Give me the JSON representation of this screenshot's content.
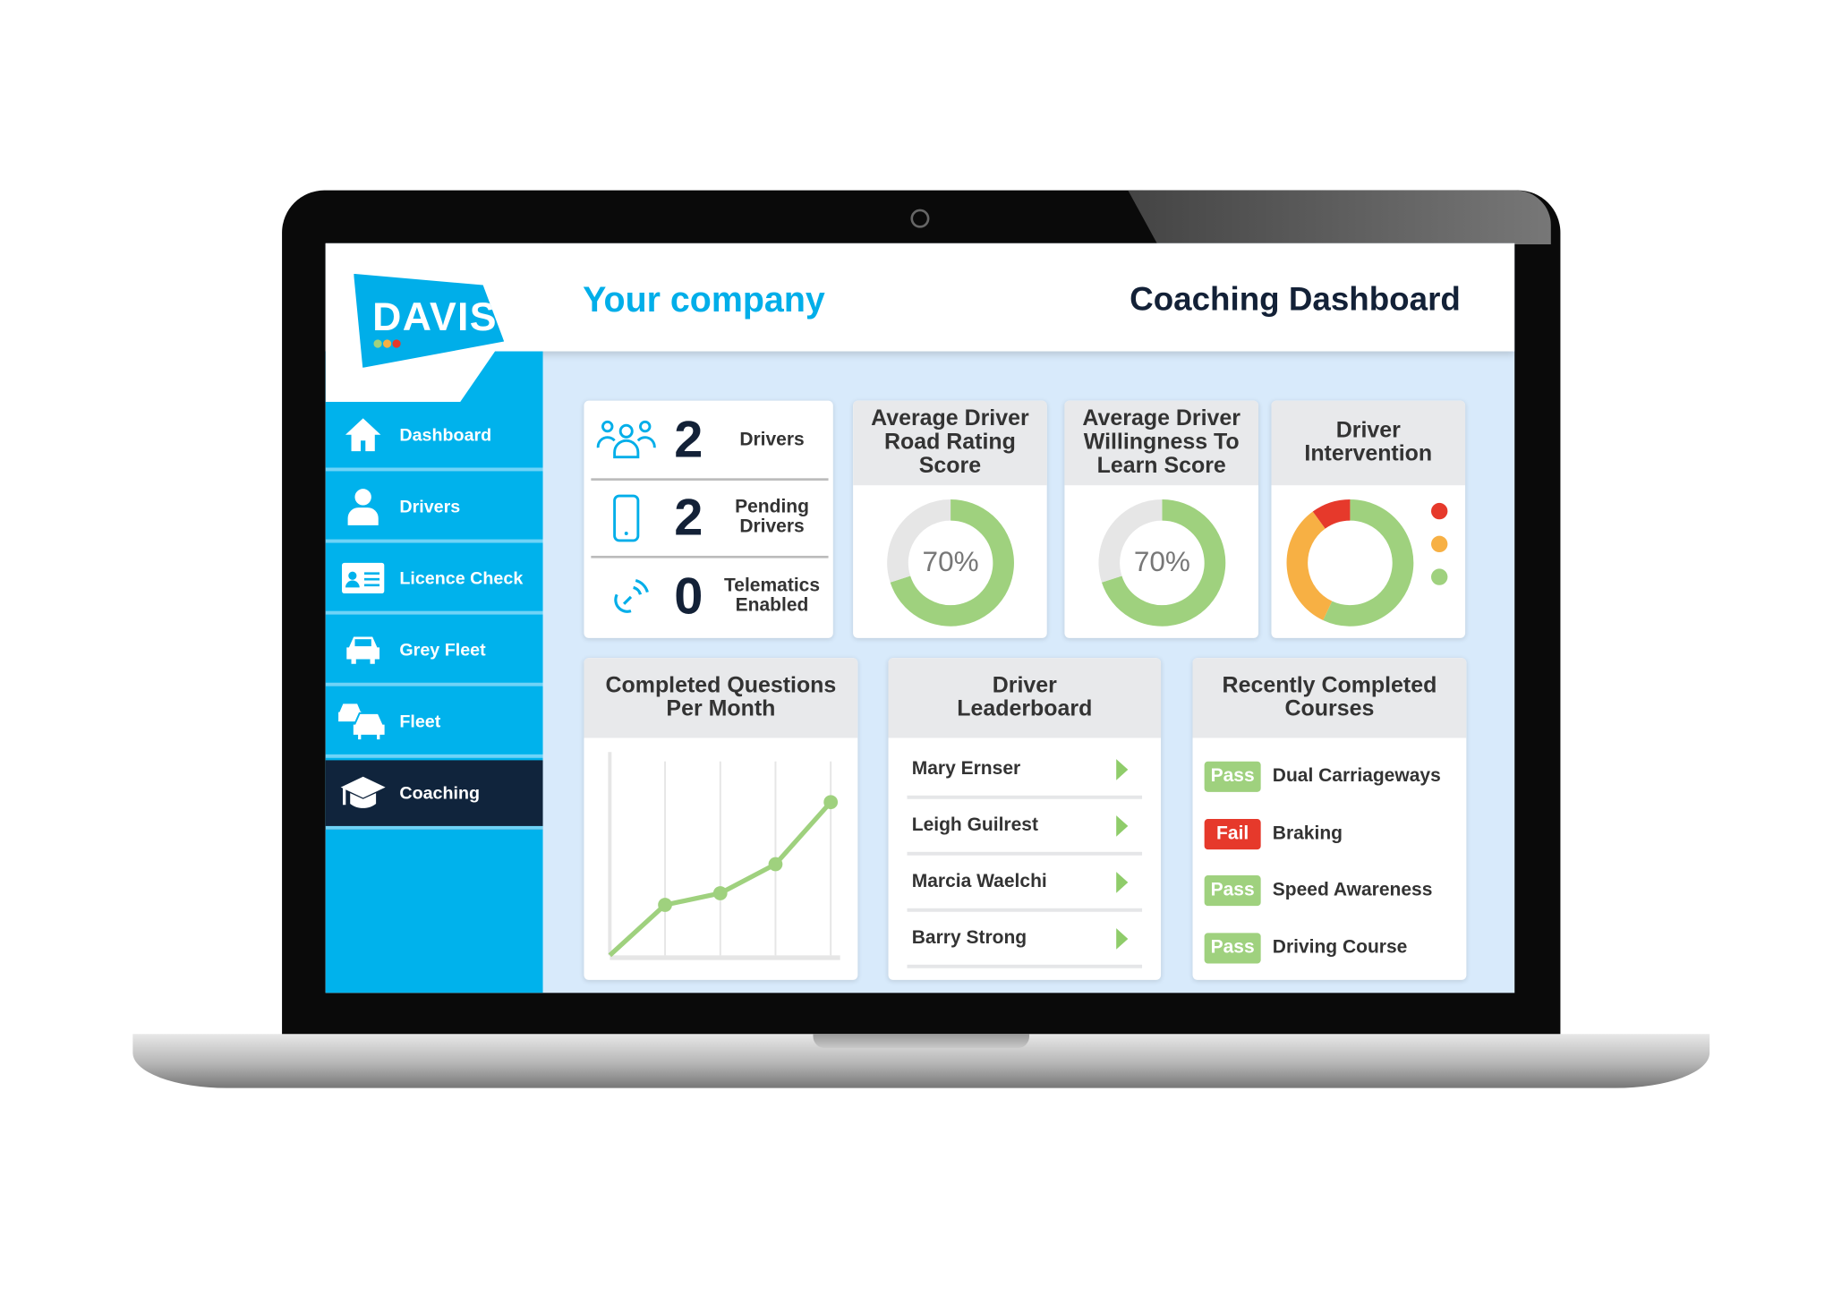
{
  "brand": {
    "logo_text": "DAVIS",
    "company": "Your company",
    "title": "Coaching Dashboard",
    "accent": "#00aee9",
    "navy": "#132137",
    "green": "#9fd17e",
    "orange": "#f7b044",
    "red": "#e6392b"
  },
  "sidebar": {
    "items": [
      {
        "label": "Dashboard",
        "icon": "home-icon"
      },
      {
        "label": "Drivers",
        "icon": "person-icon"
      },
      {
        "label": "Licence Check",
        "icon": "id-card-icon"
      },
      {
        "label": "Grey Fleet",
        "icon": "car-icon"
      },
      {
        "label": "Fleet",
        "icon": "cars-icon"
      },
      {
        "label": "Coaching",
        "icon": "graduation-cap-icon",
        "active": true
      }
    ]
  },
  "stats": [
    {
      "value": "2",
      "label": "Drivers",
      "icon": "group-icon"
    },
    {
      "value": "2",
      "label": "Pending Drivers",
      "icon": "phone-icon"
    },
    {
      "value": "0",
      "label": "Telematics Enabled",
      "icon": "satellite-icon"
    }
  ],
  "gauges": [
    {
      "title": "Average Driver Road Rating Score",
      "value": 70,
      "label": "70%"
    },
    {
      "title": "Average Driver Willingness To Learn Score",
      "value": 70,
      "label": "70%"
    }
  ],
  "intervention": {
    "title": "Driver Intervention",
    "segments": [
      {
        "color": "#9fd17e",
        "value": 57
      },
      {
        "color": "#f7b044",
        "value": 33
      },
      {
        "color": "#e6392b",
        "value": 10
      }
    ],
    "legend": [
      "#e6392b",
      "#f7b044",
      "#9fd17e"
    ]
  },
  "chart_data": {
    "type": "line",
    "title": "Completed Questions Per Month",
    "x": [
      1,
      2,
      3,
      4,
      5
    ],
    "values": [
      0,
      26,
      32,
      47,
      79
    ],
    "ylim": [
      0,
      100
    ],
    "grid": "vertical",
    "color": "#9fd17e"
  },
  "leaderboard": {
    "title": "Driver Leaderboard",
    "items": [
      "Mary Ernser",
      "Leigh Guilrest",
      "Marcia Waelchi",
      "Barry Strong"
    ]
  },
  "courses": {
    "title": "Recently Completed Courses",
    "items": [
      {
        "status": "Pass",
        "name": "Dual Carriageways"
      },
      {
        "status": "Fail",
        "name": "Braking"
      },
      {
        "status": "Pass",
        "name": "Speed Awareness"
      },
      {
        "status": "Pass",
        "name": "Driving Course"
      }
    ]
  }
}
